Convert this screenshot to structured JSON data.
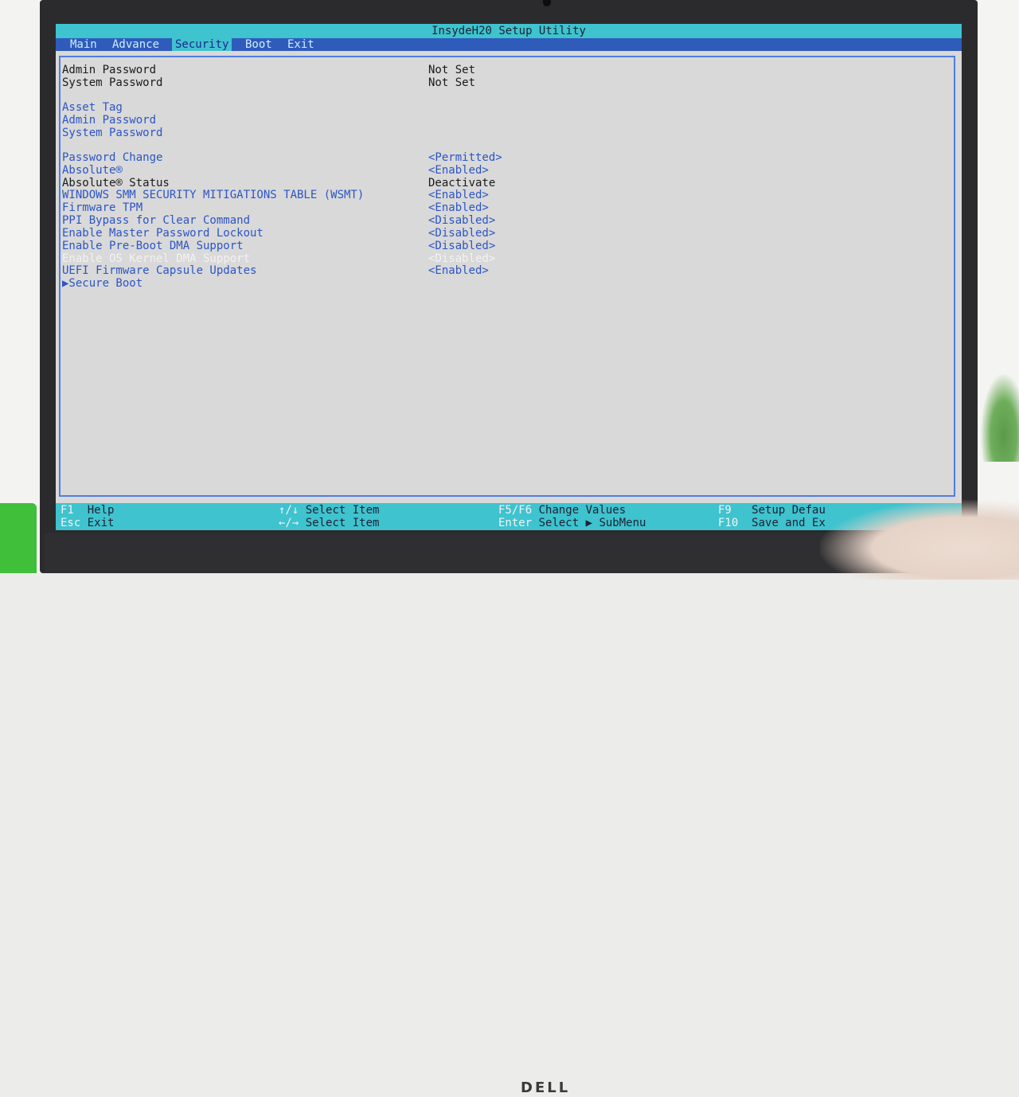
{
  "window": {
    "title": "InsydeH20 Setup Utility"
  },
  "menu": [
    {
      "label": "Main"
    },
    {
      "label": "Advance"
    },
    {
      "label": "Security"
    },
    {
      "label": "Boot"
    },
    {
      "label": "Exit"
    }
  ],
  "active_menu": "Security",
  "items": [
    {
      "label": "Admin Password",
      "value": "Not Set"
    },
    {
      "label": "System Password",
      "value": "Not Set"
    },
    {
      "label": "Asset Tag",
      "value": ""
    },
    {
      "label": "Admin Password",
      "value": ""
    },
    {
      "label": "System Password",
      "value": ""
    },
    {
      "label": "Password Change",
      "value": "<Permitted>"
    },
    {
      "label": "Absolute®",
      "value": "<Enabled>"
    },
    {
      "label": "Absolute® Status",
      "value": "Deactivate"
    },
    {
      "label": "WINDOWS SMM SECURITY MITIGATIONS TABLE (WSMT)",
      "value": "<Enabled>"
    },
    {
      "label": "Firmware TPM",
      "value": "<Enabled>"
    },
    {
      "label": "PPI Bypass for Clear Command",
      "value": "<Disabled>"
    },
    {
      "label": "Enable Master Password Lockout",
      "value": "<Disabled>"
    },
    {
      "label": "Enable Pre-Boot DMA Support",
      "value": "<Disabled>"
    },
    {
      "label": "Enable OS Kernel DMA Support",
      "value": "<Disabled>"
    },
    {
      "label": "UEFI Firmware Capsule Updates",
      "value": "<Enabled>"
    },
    {
      "label": "▶Secure Boot",
      "value": ""
    }
  ],
  "hints": [
    {
      "key": "F1",
      "action": "Help"
    },
    {
      "key": "Esc",
      "action": "Exit"
    },
    {
      "key": "↑/↓",
      "action": "Select Item"
    },
    {
      "key": "←/→",
      "action": "Select Item"
    },
    {
      "key": "F5/F6",
      "action": "Change Values"
    },
    {
      "key": "Enter",
      "action": "Select ▶ SubMenu"
    },
    {
      "key": "F9",
      "action": "Setup Defau"
    },
    {
      "key": "F10",
      "action": "Save and Ex"
    }
  ],
  "bezel_logo": "DELL",
  "colors": {
    "title_bar": "#3ec3cf",
    "menu_bar": "#2f5bbb",
    "panel_bg": "#d9d9d9",
    "link_text": "#2c55c6",
    "highlight_text": "#f2f2f2"
  }
}
